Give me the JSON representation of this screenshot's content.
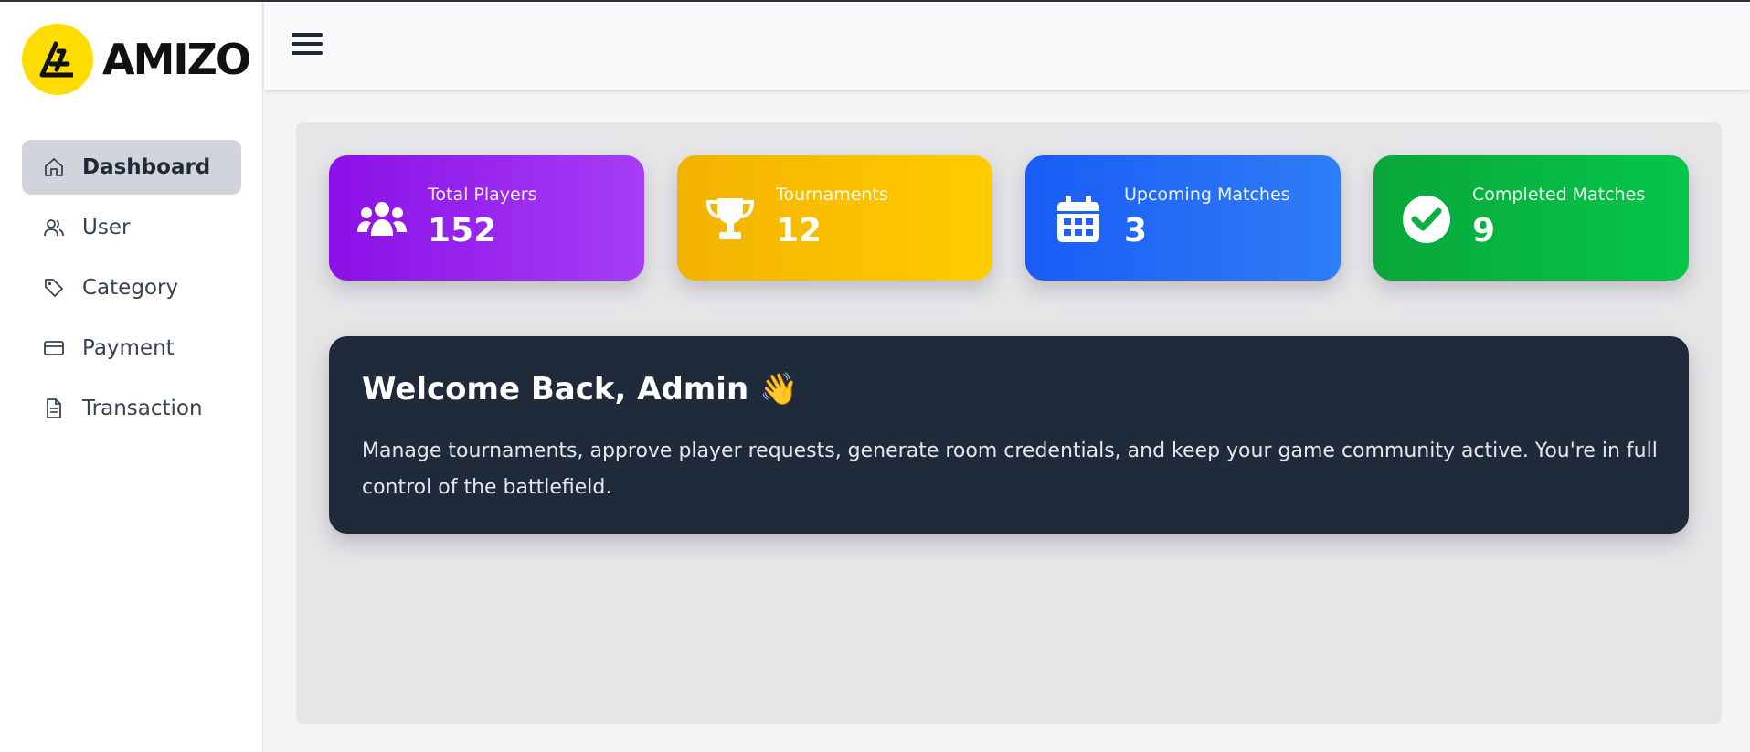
{
  "app": {
    "logo_text": "AMIZO"
  },
  "sidebar": {
    "items": [
      {
        "label": "Dashboard",
        "icon": "home-icon",
        "active": true
      },
      {
        "label": "User",
        "icon": "users-icon",
        "active": false
      },
      {
        "label": "Category",
        "icon": "tag-icon",
        "active": false
      },
      {
        "label": "Payment",
        "icon": "credit-card-icon",
        "active": false
      },
      {
        "label": "Transaction",
        "icon": "document-icon",
        "active": false
      }
    ]
  },
  "header": {
    "menu_icon": "hamburger-icon"
  },
  "stats": [
    {
      "label": "Total Players",
      "value": "152",
      "icon": "users-group-icon",
      "color_from": "#8b10e6",
      "color_to": "#a63df7"
    },
    {
      "label": "Tournaments",
      "value": "12",
      "icon": "trophy-icon",
      "color_from": "#f2b200",
      "color_to": "#ffcc00"
    },
    {
      "label": "Upcoming Matches",
      "value": "3",
      "icon": "calendar-icon",
      "color_from": "#1a5cf5",
      "color_to": "#2f7df7"
    },
    {
      "label": "Completed Matches",
      "value": "9",
      "icon": "check-circle-icon",
      "color_from": "#09a63a",
      "color_to": "#05c64a"
    }
  ],
  "welcome": {
    "title": "Welcome Back, Admin",
    "emoji": "👋",
    "message": "Manage tournaments, approve player requests, generate room credentials, and keep your game community active. You're in full control of the battlefield."
  }
}
